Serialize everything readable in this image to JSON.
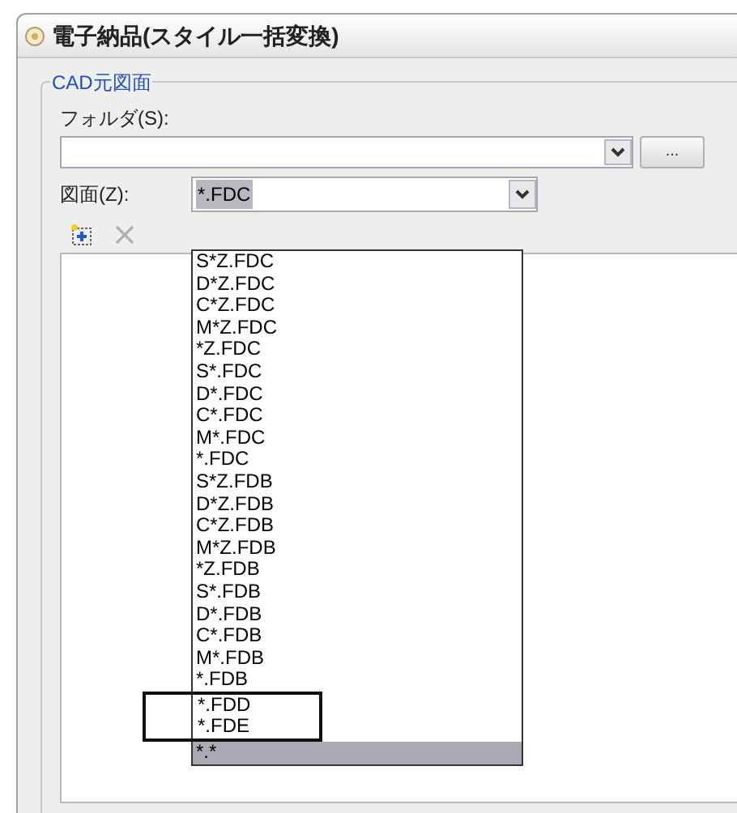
{
  "window": {
    "title": "電子納品(スタイル一括変換)"
  },
  "group": {
    "title": "CAD元図面"
  },
  "folder": {
    "label": "フォルダ(S):",
    "browse_label": "..."
  },
  "drawing": {
    "label": "図面(Z):",
    "value": "*.FDC",
    "expanded": true
  },
  "dropdown": {
    "items": [
      {
        "label": "S*Z.FDC",
        "selected": false,
        "boxed": false
      },
      {
        "label": "D*Z.FDC",
        "selected": false,
        "boxed": false
      },
      {
        "label": "C*Z.FDC",
        "selected": false,
        "boxed": false
      },
      {
        "label": "M*Z.FDC",
        "selected": false,
        "boxed": false
      },
      {
        "label": "*Z.FDC",
        "selected": false,
        "boxed": false
      },
      {
        "label": "S*.FDC",
        "selected": false,
        "boxed": false
      },
      {
        "label": "D*.FDC",
        "selected": false,
        "boxed": false
      },
      {
        "label": "C*.FDC",
        "selected": false,
        "boxed": false
      },
      {
        "label": "M*.FDC",
        "selected": false,
        "boxed": false
      },
      {
        "label": "*.FDC",
        "selected": false,
        "boxed": false
      },
      {
        "label": "S*Z.FDB",
        "selected": false,
        "boxed": false
      },
      {
        "label": "D*Z.FDB",
        "selected": false,
        "boxed": false
      },
      {
        "label": "C*Z.FDB",
        "selected": false,
        "boxed": false
      },
      {
        "label": "M*Z.FDB",
        "selected": false,
        "boxed": false
      },
      {
        "label": "*Z.FDB",
        "selected": false,
        "boxed": false
      },
      {
        "label": "S*.FDB",
        "selected": false,
        "boxed": false
      },
      {
        "label": "D*.FDB",
        "selected": false,
        "boxed": false
      },
      {
        "label": "C*.FDB",
        "selected": false,
        "boxed": false
      },
      {
        "label": "M*.FDB",
        "selected": false,
        "boxed": false
      },
      {
        "label": "*.FDB",
        "selected": false,
        "boxed": false
      },
      {
        "label": "*.FDD",
        "selected": false,
        "boxed": true
      },
      {
        "label": "*.FDE",
        "selected": false,
        "boxed": true
      },
      {
        "label": "*.*",
        "selected": true,
        "boxed": false
      }
    ]
  }
}
